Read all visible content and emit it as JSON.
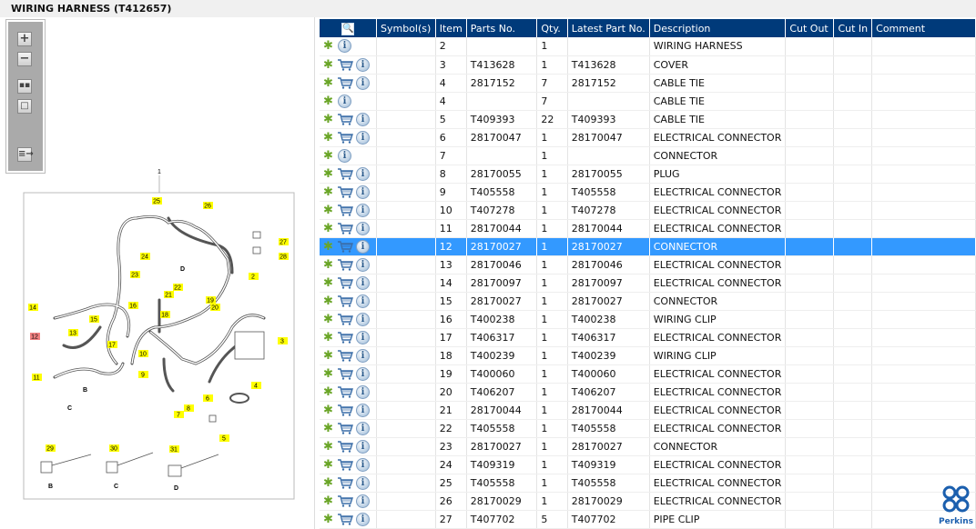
{
  "title": "WIRING HARNESS (T412657)",
  "diagram": {
    "main_label": "1",
    "callouts": [
      "25",
      "26",
      "27",
      "28",
      "24",
      "23",
      "22",
      "21",
      "2",
      "19",
      "20",
      "14",
      "16",
      "15",
      "18",
      "13",
      "12",
      "17",
      "10",
      "3",
      "11",
      "9",
      "6",
      "4",
      "8",
      "7",
      "5",
      "29",
      "30",
      "31"
    ],
    "letters": [
      "D",
      "B",
      "C",
      "B",
      "C",
      "D"
    ],
    "highlight_color": "#ffff00",
    "selected_color": "#f08080"
  },
  "table": {
    "headers": [
      "",
      "Symbol(s)",
      "Item",
      "Parts No.",
      "Qty.",
      "Latest Part No.",
      "Description",
      "Cut Out",
      "Cut In",
      "Comment"
    ],
    "rows": [
      {
        "cart": false,
        "item": "2",
        "part": "",
        "qty": "1",
        "latest": "",
        "desc": "WIRING HARNESS"
      },
      {
        "cart": true,
        "item": "3",
        "part": "T413628",
        "qty": "1",
        "latest": "T413628",
        "desc": "COVER"
      },
      {
        "cart": true,
        "item": "4",
        "part": "2817152",
        "qty": "7",
        "latest": "2817152",
        "desc": "CABLE TIE"
      },
      {
        "cart": false,
        "item": "4",
        "part": "",
        "qty": "7",
        "latest": "",
        "desc": "CABLE TIE"
      },
      {
        "cart": true,
        "item": "5",
        "part": "T409393",
        "qty": "22",
        "latest": "T409393",
        "desc": "CABLE TIE"
      },
      {
        "cart": true,
        "item": "6",
        "part": "28170047",
        "qty": "1",
        "latest": "28170047",
        "desc": "ELECTRICAL CONNECTOR"
      },
      {
        "cart": false,
        "item": "7",
        "part": "",
        "qty": "1",
        "latest": "",
        "desc": "CONNECTOR"
      },
      {
        "cart": true,
        "item": "8",
        "part": "28170055",
        "qty": "1",
        "latest": "28170055",
        "desc": "PLUG"
      },
      {
        "cart": true,
        "item": "9",
        "part": "T405558",
        "qty": "1",
        "latest": "T405558",
        "desc": "ELECTRICAL CONNECTOR"
      },
      {
        "cart": true,
        "item": "10",
        "part": "T407278",
        "qty": "1",
        "latest": "T407278",
        "desc": "ELECTRICAL CONNECTOR"
      },
      {
        "cart": true,
        "item": "11",
        "part": "28170044",
        "qty": "1",
        "latest": "28170044",
        "desc": "ELECTRICAL CONNECTOR"
      },
      {
        "cart": true,
        "item": "12",
        "part": "28170027",
        "qty": "1",
        "latest": "28170027",
        "desc": "CONNECTOR",
        "selected": true
      },
      {
        "cart": true,
        "item": "13",
        "part": "28170046",
        "qty": "1",
        "latest": "28170046",
        "desc": "ELECTRICAL CONNECTOR"
      },
      {
        "cart": true,
        "item": "14",
        "part": "28170097",
        "qty": "1",
        "latest": "28170097",
        "desc": "ELECTRICAL CONNECTOR"
      },
      {
        "cart": true,
        "item": "15",
        "part": "28170027",
        "qty": "1",
        "latest": "28170027",
        "desc": "CONNECTOR"
      },
      {
        "cart": true,
        "item": "16",
        "part": "T400238",
        "qty": "1",
        "latest": "T400238",
        "desc": "WIRING CLIP"
      },
      {
        "cart": true,
        "item": "17",
        "part": "T406317",
        "qty": "1",
        "latest": "T406317",
        "desc": "ELECTRICAL CONNECTOR"
      },
      {
        "cart": true,
        "item": "18",
        "part": "T400239",
        "qty": "1",
        "latest": "T400239",
        "desc": "WIRING CLIP"
      },
      {
        "cart": true,
        "item": "19",
        "part": "T400060",
        "qty": "1",
        "latest": "T400060",
        "desc": "ELECTRICAL CONNECTOR"
      },
      {
        "cart": true,
        "item": "20",
        "part": "T406207",
        "qty": "1",
        "latest": "T406207",
        "desc": "ELECTRICAL CONNECTOR"
      },
      {
        "cart": true,
        "item": "21",
        "part": "28170044",
        "qty": "1",
        "latest": "28170044",
        "desc": "ELECTRICAL CONNECTOR"
      },
      {
        "cart": true,
        "item": "22",
        "part": "T405558",
        "qty": "1",
        "latest": "T405558",
        "desc": "ELECTRICAL CONNECTOR"
      },
      {
        "cart": true,
        "item": "23",
        "part": "28170027",
        "qty": "1",
        "latest": "28170027",
        "desc": "CONNECTOR"
      },
      {
        "cart": true,
        "item": "24",
        "part": "T409319",
        "qty": "1",
        "latest": "T409319",
        "desc": "ELECTRICAL CONNECTOR"
      },
      {
        "cart": true,
        "item": "25",
        "part": "T405558",
        "qty": "1",
        "latest": "T405558",
        "desc": "ELECTRICAL CONNECTOR"
      },
      {
        "cart": true,
        "item": "26",
        "part": "28170029",
        "qty": "1",
        "latest": "28170029",
        "desc": "ELECTRICAL CONNECTOR"
      },
      {
        "cart": true,
        "item": "27",
        "part": "T407702",
        "qty": "5",
        "latest": "T407702",
        "desc": "PIPE CLIP"
      }
    ]
  },
  "logo": {
    "text": "Perkins",
    "color": "#1b5fae"
  },
  "colors": {
    "header": "#003a7a",
    "selected": "#3399ff"
  }
}
